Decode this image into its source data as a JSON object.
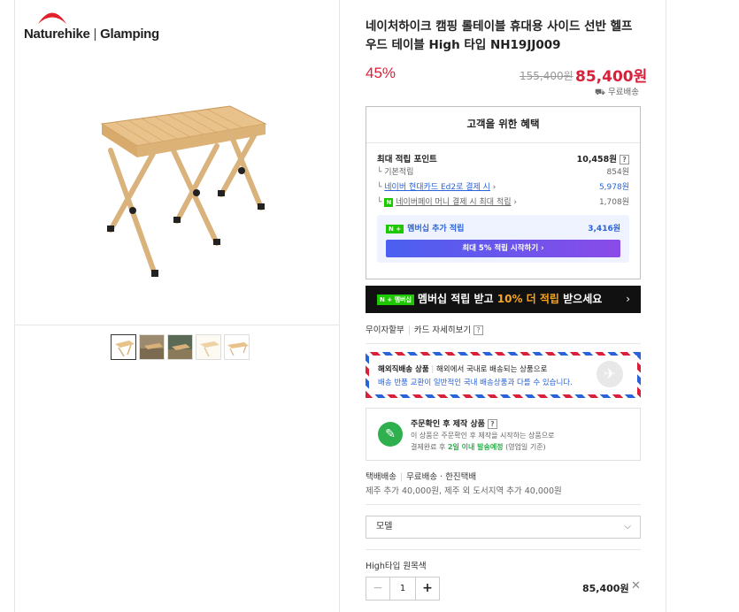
{
  "brand": {
    "logo_left": "Naturehike",
    "logo_right": "Glamping"
  },
  "product": {
    "title": "네이처하이크 캠핑 롤테이블 휴대용 사이드 선반 헬프 우드 테이블 High 타입 NH19JJ009",
    "discount": "45%",
    "original_price": "155,400원",
    "price": "85,400원",
    "shipping": "무료배송"
  },
  "benefit": {
    "title": "고객을 위한 혜택",
    "max_points_label": "최대 적립 포인트",
    "max_points_value": "10,458원",
    "basic_label": "기본적립",
    "basic_value": "854원",
    "card_label": "네이버 현대카드 Ed2로 결제 시",
    "card_value": "5,978원",
    "npay_label": "네이버페이 머니 결제 시 최대 적립",
    "npay_value": "1,708원",
    "membership_label": "멤버십 추가 적립",
    "membership_value": "3,416원",
    "cta": "최대 5% 적립 시작하기 ›"
  },
  "banner": {
    "badge": "N + 멤버십",
    "pre": "멤버십 적립 받고 ",
    "highlight": "10% 더 적립",
    "post": " 받으세요",
    "chevron": "›"
  },
  "install": {
    "label1": "무이자할부",
    "label2": "카드 자세히보기"
  },
  "overseas": {
    "title": "해외직배송 상품",
    "desc": "해외에서 국내로 배송되는 상품으로",
    "note": "배송 반품 교환이 일반적인 국내 배송상품과 다를 수 있습니다."
  },
  "order": {
    "title": "주문확인 후 제작 상품",
    "line1": "이 상품은 주문확인 후 제작을 시작하는 상품으로",
    "line2_pre": "결제완료 후 ",
    "line2_hl": "2일 이내 발송예정",
    "line2_post": " (영업일 기준)"
  },
  "delivery": {
    "type": "택배배송",
    "fee": "무료배송 · 한진택배",
    "extra": "제주 추가 40,000원, 제주 외 도서지역 추가 40,000원"
  },
  "select": {
    "label": "모델"
  },
  "option": {
    "name": "High타입 원목색",
    "qty": "1",
    "price": "85,400원"
  }
}
